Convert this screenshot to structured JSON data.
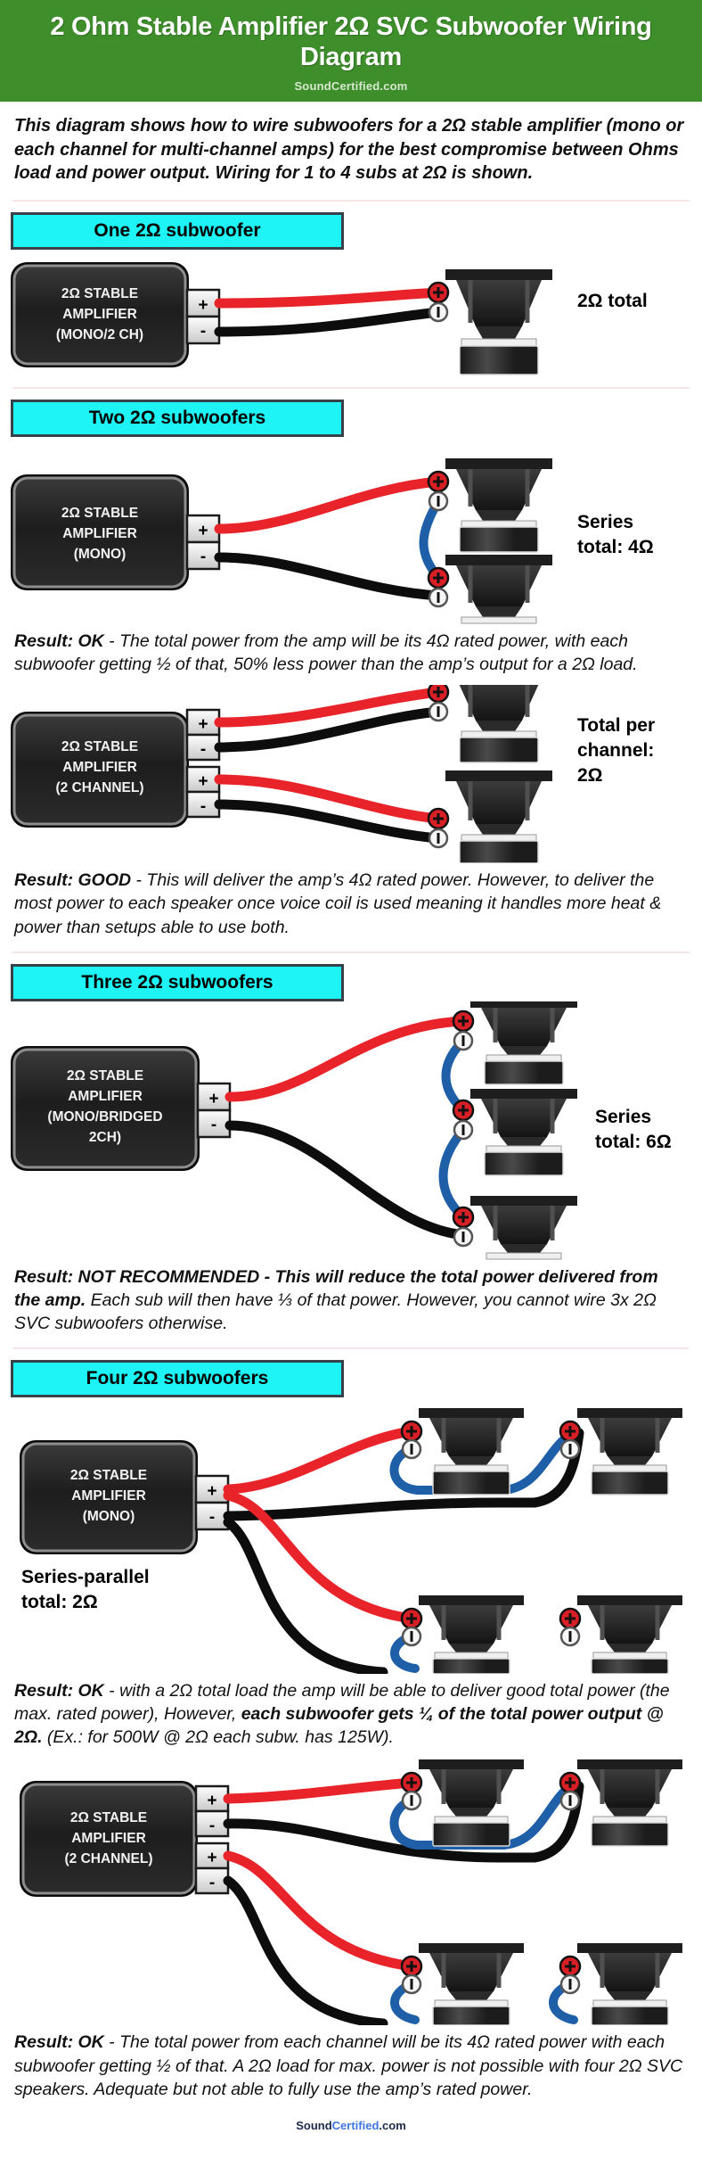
{
  "header": {
    "title": "2 Ohm Stable Amplifier 2Ω SVC Subwoofer Wiring Diagram",
    "brand": "SoundCertified.com",
    "bg_color": "#3e8f2c"
  },
  "intro": {
    "part1": "This diagram shows how to wire subwoofers for a 2Ω stable amplifier (mono or ",
    "emphasis": "each",
    "part2": " channel for multi-channel amps) for the best compromise between Ohms load and power output. Wiring for 1 to 4 subs at 2Ω is shown."
  },
  "colors": {
    "accent_cyan": "#1ef3f6",
    "wire_positive": "#e8242a",
    "wire_negative": "#0d0d0d",
    "wire_link": "#1e5fa8",
    "amp_body": "#242424",
    "header_green": "#3e8f2c"
  },
  "sections": [
    {
      "pill": "One 2Ω subwoofer",
      "diagrams": [
        {
          "amp_lines": [
            "2Ω STABLE",
            "AMPLIFIER",
            "(MONO/2 CH)"
          ],
          "terminals": [
            "+",
            "-"
          ],
          "ohm_label": [
            "2Ω total"
          ],
          "speaker_count": 1
        }
      ],
      "result": null
    },
    {
      "pill": "Two 2Ω subwoofers",
      "diagrams": [
        {
          "amp_lines": [
            "2Ω STABLE",
            "AMPLIFIER",
            "(MONO)"
          ],
          "terminals": [
            "+",
            "-"
          ],
          "ohm_label": [
            "Series",
            "total: 4Ω"
          ],
          "speaker_count": 2
        }
      ],
      "result": {
        "bold": "Result: OK",
        "text": " - The total power from the amp will be its 4Ω rated power, with each subwoofer getting ½ of that, 50% less power than the amp’s output for a 2Ω load."
      }
    },
    {
      "pill": null,
      "diagrams": [
        {
          "amp_lines": [
            "2Ω STABLE",
            "AMPLIFIER",
            "(2 CHANNEL)"
          ],
          "terminals": [
            "+",
            "-",
            "+",
            "-"
          ],
          "ohm_label": [
            "Total per",
            "channel:",
            "2Ω"
          ],
          "speaker_count": 2
        }
      ],
      "result": {
        "bold": "Result: GOOD",
        "text": " - This will deliver the amp’s 4Ω rated power. However, to deliver the most power to each speaker once voice coil is used meaning it handles more heat & power than setups able to use both."
      }
    },
    {
      "pill": "Three 2Ω subwoofers",
      "diagrams": [
        {
          "amp_lines": [
            "2Ω STABLE",
            "AMPLIFIER",
            "(MONO/BRIDGED",
            "2CH)"
          ],
          "terminals": [
            "+",
            "-"
          ],
          "ohm_label": [
            "Series",
            "total: 6Ω"
          ],
          "speaker_count": 3
        }
      ],
      "result": {
        "bold": "Result: NOT RECOMMENDED - This will reduce the total power delivered from the amp.",
        "text": " Each sub will then have ⅓ of that power. However, you cannot wire 3x 2Ω SVC subwoofers otherwise."
      }
    },
    {
      "pill": "Four 2Ω subwoofers",
      "diagrams": [
        {
          "amp_lines": [
            "2Ω STABLE",
            "AMPLIFIER",
            "(MONO)"
          ],
          "terminals": [
            "+",
            "-"
          ],
          "ohm_label": [
            "Series-parallel",
            "total: 2Ω"
          ],
          "speaker_count": 4
        }
      ],
      "result": {
        "bold": "Result: OK",
        "text": " - with a 2Ω total load the amp will be able to deliver good total power (the max. rated power), However, ",
        "bold2": "each subwoofer gets ¼ of the total power output @ 2Ω.",
        "text2": " (Ex.: for 500W @ 2Ω each subw. has 125W)."
      }
    },
    {
      "pill": null,
      "diagrams": [
        {
          "amp_lines": [
            "2Ω STABLE",
            "AMPLIFIER",
            "(2 CHANNEL)"
          ],
          "terminals": [
            "+",
            "-",
            "+",
            "-"
          ],
          "ohm_label": [],
          "speaker_count": 4
        }
      ],
      "result": {
        "bold": "Result: OK",
        "text": " - The total power from each channel will be its 4Ω rated power with each subwoofer getting ½ of that. A 2Ω load for max. power is not possible with four 2Ω SVC speakers. Adequate but not able to fully use the amp’s rated power."
      }
    }
  ],
  "footer": {
    "part1": "Sound",
    "part2": "Certified",
    "part3": ".com"
  }
}
